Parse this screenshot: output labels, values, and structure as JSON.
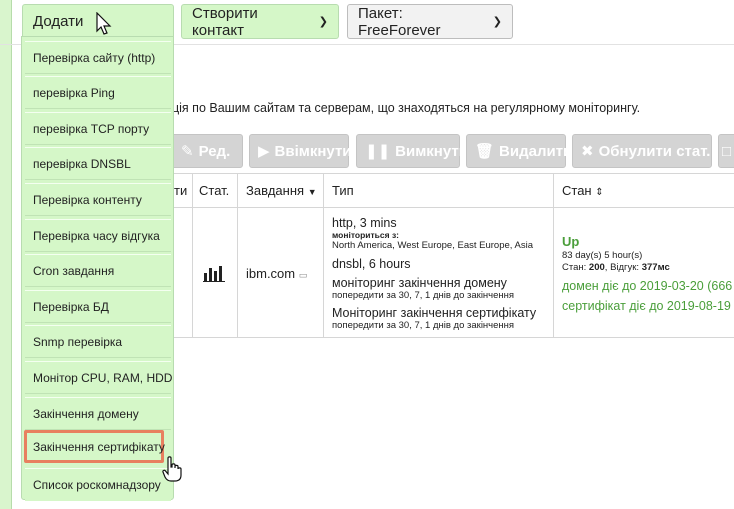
{
  "toolbar": {
    "add_label": "Додати",
    "create_contact_label": "Створити контакт",
    "package_label": "Пакет: FreeForever"
  },
  "dropdown": {
    "items": [
      "Перевірка сайту (http)",
      "перевірка Ping",
      "перевірка TCP порту",
      "перевірка DNSBL",
      "Перевірка контенту",
      "Перевірка часу відгука",
      "Cron завдання",
      "Перевірка БД",
      "Snmp перевірка",
      "Монітор CPU, RAM, HDD",
      "Закінчення домену",
      "Закінчення сертифікату",
      "Список роскомнадзору"
    ],
    "active_index": 11
  },
  "info_text": "ція по Вашим сайтам та серверам, що знаходяться на регулярному моніторингу.",
  "actions": {
    "edit": "Ред.",
    "enable": "Ввімкнути",
    "disable": "Вимкнути",
    "delete": "Видалити",
    "reset_stats": "Обнулити стат."
  },
  "table": {
    "headers": {
      "partial": "ти",
      "stat": "Стат.",
      "task": "Завдання",
      "type": "Тип",
      "state": "Стан"
    },
    "row": {
      "task": "ibm.com",
      "type_lines": {
        "http": "http, 3 mins",
        "monitored_from_label": "моніториться з:",
        "monitored_from": "North America, West Europe, East Europe, Asia",
        "dnsbl": "dnsbl, 6 hours",
        "domain_monitoring": "моніторинг закінчення домену",
        "domain_warn": "попередити за 30, 7, 1 днів до закінчення",
        "cert_monitoring": "Моніторинг закінчення сертифікату",
        "cert_warn": "попередити за 30, 7, 1 днів до закінчення"
      },
      "state": {
        "status": "Up",
        "uptime": "83 day(s) 5 hour(s)",
        "state_label": "Стан:",
        "state_code": "200",
        "response_label": "Відгук:",
        "response_time": "377мс",
        "domain_expiry": "домен діє до 2019-03-20 (666",
        "cert_expiry": "сертифікат діє до 2019-08-19"
      }
    }
  },
  "colors": {
    "green_bg": "#d5f7c8",
    "status_green": "#4a9e3a",
    "highlight": "#e8805f"
  }
}
